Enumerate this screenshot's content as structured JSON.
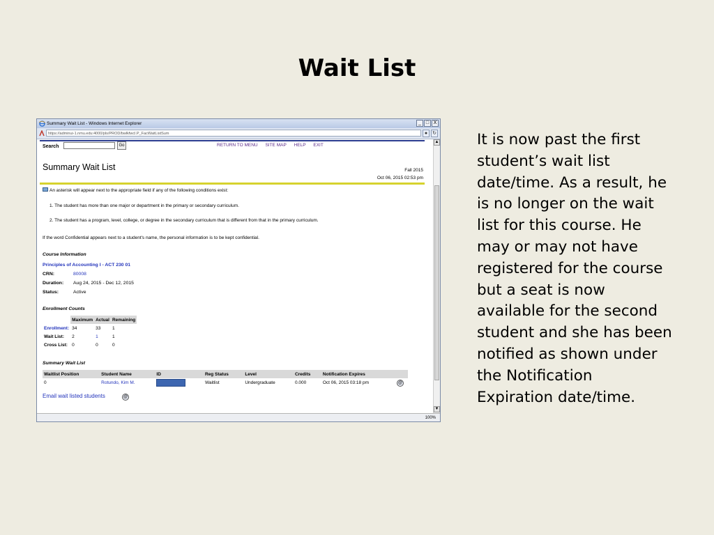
{
  "slide": {
    "title": "Wait List",
    "body": "It is now past the first student’s wait list date/time.  As a result, he is no longer on the wait list for this course.  He may or may not have registered for the course but a seat is now available for the second student and she has been notified as shown under the Notification Expiration date/time."
  },
  "browser": {
    "window_title": "Summary Wait List - Windows Internet Explorer",
    "url": "https://adminui-1.nmu.edu:4000/pls/PROD/bwlkfwcl.P_FacWaitListSum",
    "zoom": "100%",
    "buttons": {
      "minimize": "_",
      "maximize": "□",
      "close": "X"
    }
  },
  "page": {
    "search_label": "Search",
    "search_value": "",
    "go_label": "Go",
    "nav_links": [
      "RETURN TO MENU",
      "SITE MAP",
      "HELP",
      "EXIT"
    ],
    "title": "Summary Wait List",
    "term": "Fall 2015",
    "datetime": "Oct 06, 2015 02:53 pm",
    "notice": "An asterisk will appear next to the appropriate field if any of the following conditions exist:",
    "condition_1": "1. The student has more than one major or department in the primary or secondary curriculum.",
    "condition_2": "2. The student has a program, level, college, or degree in the secondary curriculum that is different from that in the primary curriculum.",
    "confidential_note": "If the word Confidential appears next to a student's name, the personal information is to be kept confidential.",
    "course_heading": "Course Information",
    "course_name": "Principles of Accounting I - ACT 230 01",
    "crn_label": "CRN:",
    "crn_value": "80008",
    "duration_label": "Duration:",
    "duration_value": "Aug 24, 2015 - Dec 12, 2015",
    "status_label": "Status:",
    "status_value": "Active",
    "enrollment_heading": "Enrollment Counts",
    "enrollment_headers": [
      "",
      "Maximum",
      "Actual",
      "Remaining"
    ],
    "enrollment_rows": [
      {
        "label": "Enrollment:",
        "maximum": "34",
        "actual": "33",
        "remaining": "1"
      },
      {
        "label": "Wait List:",
        "maximum": "2",
        "actual": "1",
        "remaining": "1"
      },
      {
        "label": "Cross List:",
        "maximum": "0",
        "actual": "0",
        "remaining": "0"
      }
    ],
    "summary_heading": "Summary Wait List",
    "waitlist_headers": [
      "Waitlist Position",
      "Student Name",
      "ID",
      "Reg Status",
      "Level",
      "Credits",
      "Notification Expires"
    ],
    "waitlist_rows": [
      {
        "position": "0",
        "student": "Rotundo, Kim M.",
        "reg_status": "Waitlist",
        "level": "Undergraduate",
        "credits": "0.000",
        "expires": "Oct 06, 2015 03:18 pm"
      }
    ],
    "email_link": "Email wait listed students"
  }
}
